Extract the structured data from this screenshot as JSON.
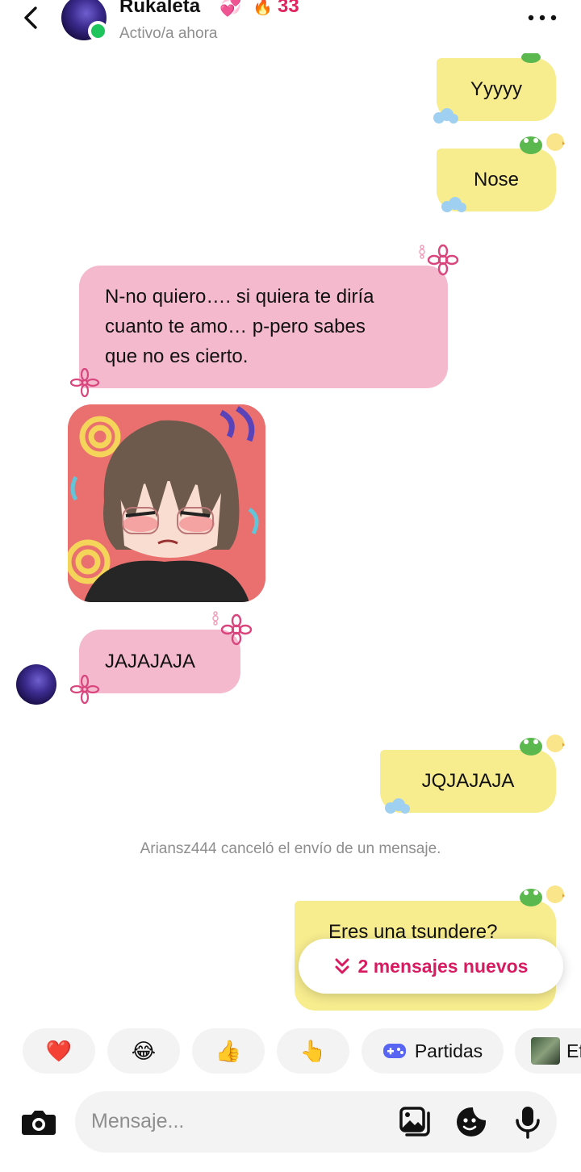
{
  "header": {
    "contact_name": "Rukaleta",
    "name_emoji": "💞",
    "streak_emoji": "🔥",
    "streak_count": "33",
    "status": "Activo/a ahora"
  },
  "messages": {
    "sent_1": "Yyyyy",
    "sent_2": "Nose",
    "received_1_line1": "N-no quiero…. si quiera te diría",
    "received_1_line2": "cuanto te amo… p-pero sabes",
    "received_1_line3": "que no es cierto.",
    "received_2": "JAJAJAJA",
    "sent_3": "JQJAJAJA",
    "system_note": "Ariansz444 canceló el envío de un mensaje.",
    "sent_4_partial": "Eres una tsundere?"
  },
  "new_messages": {
    "icon": "»",
    "label": "2 mensajes nuevos"
  },
  "quick_reactions": [
    {
      "emoji": "❤️"
    },
    {
      "emoji": "😂"
    },
    {
      "emoji": "👍"
    },
    {
      "emoji": "👆"
    }
  ],
  "games_label": "Partidas",
  "effects_label_partial": "Ef",
  "composer": {
    "placeholder": "Mensaje..."
  },
  "colors": {
    "sent_bubble": "#f7ec8e",
    "received_bubble": "#f5b9cd",
    "accent": "#d81b60",
    "online": "#1ec45c"
  }
}
